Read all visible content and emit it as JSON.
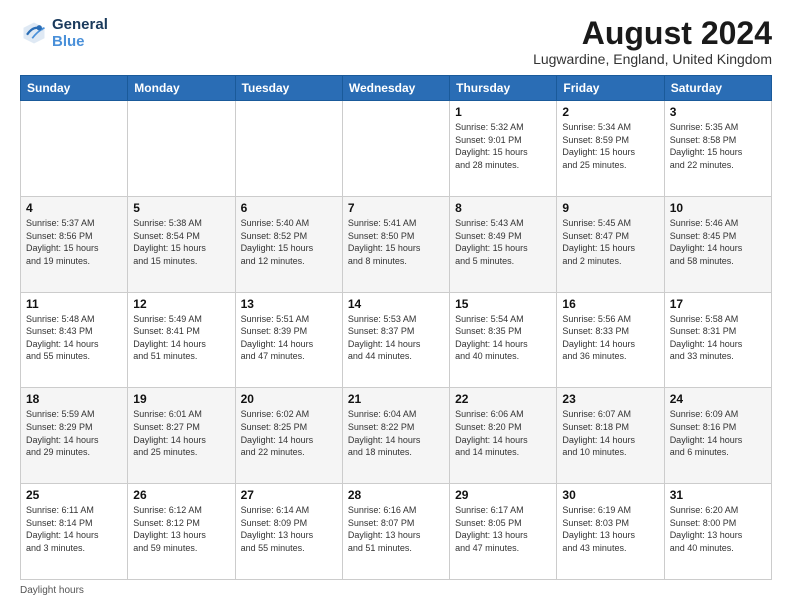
{
  "header": {
    "logo_line1": "General",
    "logo_line2": "Blue",
    "month": "August 2024",
    "location": "Lugwardine, England, United Kingdom"
  },
  "days_of_week": [
    "Sunday",
    "Monday",
    "Tuesday",
    "Wednesday",
    "Thursday",
    "Friday",
    "Saturday"
  ],
  "weeks": [
    [
      {
        "day": "",
        "info": ""
      },
      {
        "day": "",
        "info": ""
      },
      {
        "day": "",
        "info": ""
      },
      {
        "day": "",
        "info": ""
      },
      {
        "day": "1",
        "info": "Sunrise: 5:32 AM\nSunset: 9:01 PM\nDaylight: 15 hours\nand 28 minutes."
      },
      {
        "day": "2",
        "info": "Sunrise: 5:34 AM\nSunset: 8:59 PM\nDaylight: 15 hours\nand 25 minutes."
      },
      {
        "day": "3",
        "info": "Sunrise: 5:35 AM\nSunset: 8:58 PM\nDaylight: 15 hours\nand 22 minutes."
      }
    ],
    [
      {
        "day": "4",
        "info": "Sunrise: 5:37 AM\nSunset: 8:56 PM\nDaylight: 15 hours\nand 19 minutes."
      },
      {
        "day": "5",
        "info": "Sunrise: 5:38 AM\nSunset: 8:54 PM\nDaylight: 15 hours\nand 15 minutes."
      },
      {
        "day": "6",
        "info": "Sunrise: 5:40 AM\nSunset: 8:52 PM\nDaylight: 15 hours\nand 12 minutes."
      },
      {
        "day": "7",
        "info": "Sunrise: 5:41 AM\nSunset: 8:50 PM\nDaylight: 15 hours\nand 8 minutes."
      },
      {
        "day": "8",
        "info": "Sunrise: 5:43 AM\nSunset: 8:49 PM\nDaylight: 15 hours\nand 5 minutes."
      },
      {
        "day": "9",
        "info": "Sunrise: 5:45 AM\nSunset: 8:47 PM\nDaylight: 15 hours\nand 2 minutes."
      },
      {
        "day": "10",
        "info": "Sunrise: 5:46 AM\nSunset: 8:45 PM\nDaylight: 14 hours\nand 58 minutes."
      }
    ],
    [
      {
        "day": "11",
        "info": "Sunrise: 5:48 AM\nSunset: 8:43 PM\nDaylight: 14 hours\nand 55 minutes."
      },
      {
        "day": "12",
        "info": "Sunrise: 5:49 AM\nSunset: 8:41 PM\nDaylight: 14 hours\nand 51 minutes."
      },
      {
        "day": "13",
        "info": "Sunrise: 5:51 AM\nSunset: 8:39 PM\nDaylight: 14 hours\nand 47 minutes."
      },
      {
        "day": "14",
        "info": "Sunrise: 5:53 AM\nSunset: 8:37 PM\nDaylight: 14 hours\nand 44 minutes."
      },
      {
        "day": "15",
        "info": "Sunrise: 5:54 AM\nSunset: 8:35 PM\nDaylight: 14 hours\nand 40 minutes."
      },
      {
        "day": "16",
        "info": "Sunrise: 5:56 AM\nSunset: 8:33 PM\nDaylight: 14 hours\nand 36 minutes."
      },
      {
        "day": "17",
        "info": "Sunrise: 5:58 AM\nSunset: 8:31 PM\nDaylight: 14 hours\nand 33 minutes."
      }
    ],
    [
      {
        "day": "18",
        "info": "Sunrise: 5:59 AM\nSunset: 8:29 PM\nDaylight: 14 hours\nand 29 minutes."
      },
      {
        "day": "19",
        "info": "Sunrise: 6:01 AM\nSunset: 8:27 PM\nDaylight: 14 hours\nand 25 minutes."
      },
      {
        "day": "20",
        "info": "Sunrise: 6:02 AM\nSunset: 8:25 PM\nDaylight: 14 hours\nand 22 minutes."
      },
      {
        "day": "21",
        "info": "Sunrise: 6:04 AM\nSunset: 8:22 PM\nDaylight: 14 hours\nand 18 minutes."
      },
      {
        "day": "22",
        "info": "Sunrise: 6:06 AM\nSunset: 8:20 PM\nDaylight: 14 hours\nand 14 minutes."
      },
      {
        "day": "23",
        "info": "Sunrise: 6:07 AM\nSunset: 8:18 PM\nDaylight: 14 hours\nand 10 minutes."
      },
      {
        "day": "24",
        "info": "Sunrise: 6:09 AM\nSunset: 8:16 PM\nDaylight: 14 hours\nand 6 minutes."
      }
    ],
    [
      {
        "day": "25",
        "info": "Sunrise: 6:11 AM\nSunset: 8:14 PM\nDaylight: 14 hours\nand 3 minutes."
      },
      {
        "day": "26",
        "info": "Sunrise: 6:12 AM\nSunset: 8:12 PM\nDaylight: 13 hours\nand 59 minutes."
      },
      {
        "day": "27",
        "info": "Sunrise: 6:14 AM\nSunset: 8:09 PM\nDaylight: 13 hours\nand 55 minutes."
      },
      {
        "day": "28",
        "info": "Sunrise: 6:16 AM\nSunset: 8:07 PM\nDaylight: 13 hours\nand 51 minutes."
      },
      {
        "day": "29",
        "info": "Sunrise: 6:17 AM\nSunset: 8:05 PM\nDaylight: 13 hours\nand 47 minutes."
      },
      {
        "day": "30",
        "info": "Sunrise: 6:19 AM\nSunset: 8:03 PM\nDaylight: 13 hours\nand 43 minutes."
      },
      {
        "day": "31",
        "info": "Sunrise: 6:20 AM\nSunset: 8:00 PM\nDaylight: 13 hours\nand 40 minutes."
      }
    ]
  ],
  "footer": {
    "text": "Daylight hours"
  }
}
